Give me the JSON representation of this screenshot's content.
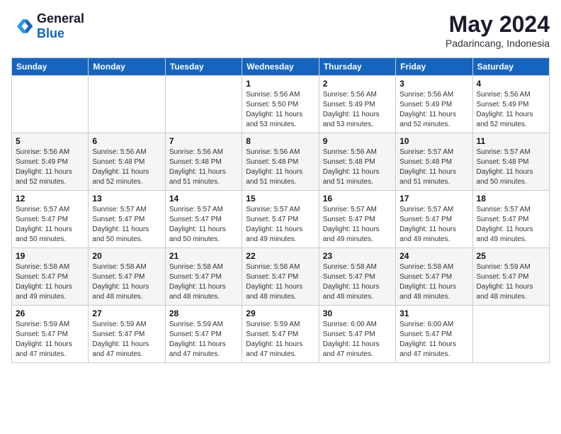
{
  "logo": {
    "text_general": "General",
    "text_blue": "Blue"
  },
  "title": "May 2024",
  "subtitle": "Padarincang, Indonesia",
  "headers": [
    "Sunday",
    "Monday",
    "Tuesday",
    "Wednesday",
    "Thursday",
    "Friday",
    "Saturday"
  ],
  "weeks": [
    [
      {
        "day": "",
        "content": ""
      },
      {
        "day": "",
        "content": ""
      },
      {
        "day": "",
        "content": ""
      },
      {
        "day": "1",
        "content": "Sunrise: 5:56 AM\nSunset: 5:50 PM\nDaylight: 11 hours\nand 53 minutes."
      },
      {
        "day": "2",
        "content": "Sunrise: 5:56 AM\nSunset: 5:49 PM\nDaylight: 11 hours\nand 53 minutes."
      },
      {
        "day": "3",
        "content": "Sunrise: 5:56 AM\nSunset: 5:49 PM\nDaylight: 11 hours\nand 52 minutes."
      },
      {
        "day": "4",
        "content": "Sunrise: 5:56 AM\nSunset: 5:49 PM\nDaylight: 11 hours\nand 52 minutes."
      }
    ],
    [
      {
        "day": "5",
        "content": "Sunrise: 5:56 AM\nSunset: 5:49 PM\nDaylight: 11 hours\nand 52 minutes."
      },
      {
        "day": "6",
        "content": "Sunrise: 5:56 AM\nSunset: 5:48 PM\nDaylight: 11 hours\nand 52 minutes."
      },
      {
        "day": "7",
        "content": "Sunrise: 5:56 AM\nSunset: 5:48 PM\nDaylight: 11 hours\nand 51 minutes."
      },
      {
        "day": "8",
        "content": "Sunrise: 5:56 AM\nSunset: 5:48 PM\nDaylight: 11 hours\nand 51 minutes."
      },
      {
        "day": "9",
        "content": "Sunrise: 5:56 AM\nSunset: 5:48 PM\nDaylight: 11 hours\nand 51 minutes."
      },
      {
        "day": "10",
        "content": "Sunrise: 5:57 AM\nSunset: 5:48 PM\nDaylight: 11 hours\nand 51 minutes."
      },
      {
        "day": "11",
        "content": "Sunrise: 5:57 AM\nSunset: 5:48 PM\nDaylight: 11 hours\nand 50 minutes."
      }
    ],
    [
      {
        "day": "12",
        "content": "Sunrise: 5:57 AM\nSunset: 5:47 PM\nDaylight: 11 hours\nand 50 minutes."
      },
      {
        "day": "13",
        "content": "Sunrise: 5:57 AM\nSunset: 5:47 PM\nDaylight: 11 hours\nand 50 minutes."
      },
      {
        "day": "14",
        "content": "Sunrise: 5:57 AM\nSunset: 5:47 PM\nDaylight: 11 hours\nand 50 minutes."
      },
      {
        "day": "15",
        "content": "Sunrise: 5:57 AM\nSunset: 5:47 PM\nDaylight: 11 hours\nand 49 minutes."
      },
      {
        "day": "16",
        "content": "Sunrise: 5:57 AM\nSunset: 5:47 PM\nDaylight: 11 hours\nand 49 minutes."
      },
      {
        "day": "17",
        "content": "Sunrise: 5:57 AM\nSunset: 5:47 PM\nDaylight: 11 hours\nand 49 minutes."
      },
      {
        "day": "18",
        "content": "Sunrise: 5:57 AM\nSunset: 5:47 PM\nDaylight: 11 hours\nand 49 minutes."
      }
    ],
    [
      {
        "day": "19",
        "content": "Sunrise: 5:58 AM\nSunset: 5:47 PM\nDaylight: 11 hours\nand 49 minutes."
      },
      {
        "day": "20",
        "content": "Sunrise: 5:58 AM\nSunset: 5:47 PM\nDaylight: 11 hours\nand 48 minutes."
      },
      {
        "day": "21",
        "content": "Sunrise: 5:58 AM\nSunset: 5:47 PM\nDaylight: 11 hours\nand 48 minutes."
      },
      {
        "day": "22",
        "content": "Sunrise: 5:58 AM\nSunset: 5:47 PM\nDaylight: 11 hours\nand 48 minutes."
      },
      {
        "day": "23",
        "content": "Sunrise: 5:58 AM\nSunset: 5:47 PM\nDaylight: 11 hours\nand 48 minutes."
      },
      {
        "day": "24",
        "content": "Sunrise: 5:58 AM\nSunset: 5:47 PM\nDaylight: 11 hours\nand 48 minutes."
      },
      {
        "day": "25",
        "content": "Sunrise: 5:59 AM\nSunset: 5:47 PM\nDaylight: 11 hours\nand 48 minutes."
      }
    ],
    [
      {
        "day": "26",
        "content": "Sunrise: 5:59 AM\nSunset: 5:47 PM\nDaylight: 11 hours\nand 47 minutes."
      },
      {
        "day": "27",
        "content": "Sunrise: 5:59 AM\nSunset: 5:47 PM\nDaylight: 11 hours\nand 47 minutes."
      },
      {
        "day": "28",
        "content": "Sunrise: 5:59 AM\nSunset: 5:47 PM\nDaylight: 11 hours\nand 47 minutes."
      },
      {
        "day": "29",
        "content": "Sunrise: 5:59 AM\nSunset: 5:47 PM\nDaylight: 11 hours\nand 47 minutes."
      },
      {
        "day": "30",
        "content": "Sunrise: 6:00 AM\nSunset: 5:47 PM\nDaylight: 11 hours\nand 47 minutes."
      },
      {
        "day": "31",
        "content": "Sunrise: 6:00 AM\nSunset: 5:47 PM\nDaylight: 11 hours\nand 47 minutes."
      },
      {
        "day": "",
        "content": ""
      }
    ]
  ]
}
